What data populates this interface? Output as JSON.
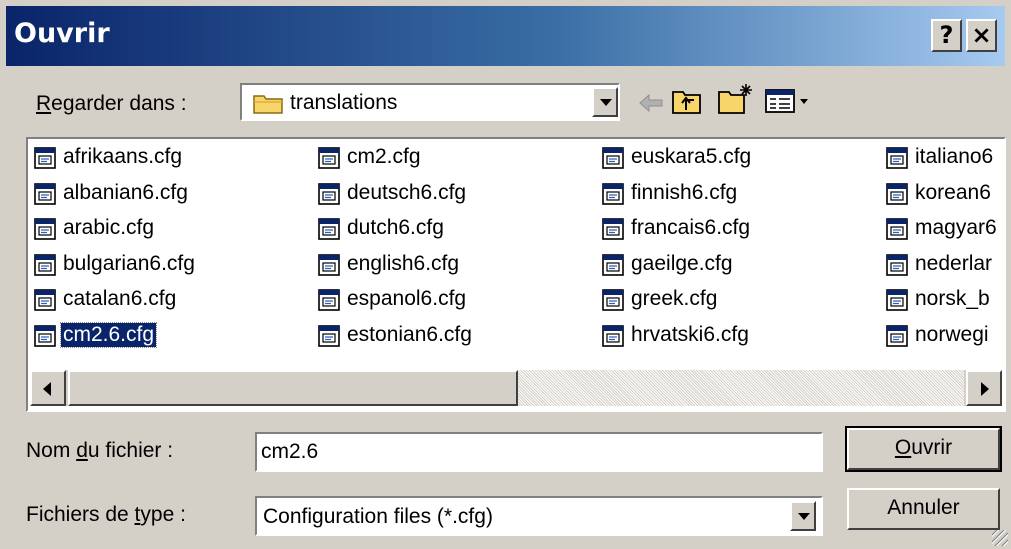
{
  "window": {
    "title": "Ouvrir",
    "help_label": "?",
    "close_label": "×"
  },
  "look_in": {
    "label_prefix": "",
    "label_access": "R",
    "label_rest": "egarder dans :",
    "value": "translations"
  },
  "files": [
    {
      "name": "afrikaans.cfg",
      "col": 0,
      "row": 0
    },
    {
      "name": "albanian6.cfg",
      "col": 0,
      "row": 1
    },
    {
      "name": "arabic.cfg",
      "col": 0,
      "row": 2
    },
    {
      "name": "bulgarian6.cfg",
      "col": 0,
      "row": 3
    },
    {
      "name": "catalan6.cfg",
      "col": 0,
      "row": 4
    },
    {
      "name": "cm2.6.cfg",
      "col": 0,
      "row": 5,
      "selected": true
    },
    {
      "name": "cm2.cfg",
      "col": 1,
      "row": 0
    },
    {
      "name": "deutsch6.cfg",
      "col": 1,
      "row": 1
    },
    {
      "name": "dutch6.cfg",
      "col": 1,
      "row": 2
    },
    {
      "name": "english6.cfg",
      "col": 1,
      "row": 3
    },
    {
      "name": "espanol6.cfg",
      "col": 1,
      "row": 4
    },
    {
      "name": "estonian6.cfg",
      "col": 1,
      "row": 5
    },
    {
      "name": "euskara5.cfg",
      "col": 2,
      "row": 0
    },
    {
      "name": "finnish6.cfg",
      "col": 2,
      "row": 1
    },
    {
      "name": "francais6.cfg",
      "col": 2,
      "row": 2
    },
    {
      "name": "gaeilge.cfg",
      "col": 2,
      "row": 3
    },
    {
      "name": "greek.cfg",
      "col": 2,
      "row": 4
    },
    {
      "name": "hrvatski6.cfg",
      "col": 2,
      "row": 5
    },
    {
      "name": "italiano6",
      "col": 3,
      "row": 0
    },
    {
      "name": "korean6",
      "col": 3,
      "row": 1
    },
    {
      "name": "magyar6",
      "col": 3,
      "row": 2
    },
    {
      "name": "nederlar",
      "col": 3,
      "row": 3
    },
    {
      "name": "norsk_b",
      "col": 3,
      "row": 4
    },
    {
      "name": "norwegi",
      "col": 3,
      "row": 5
    }
  ],
  "filename": {
    "label_pre": "Nom ",
    "label_access": "d",
    "label_post": "u fichier :",
    "value": "cm2.6"
  },
  "filetype": {
    "label_pre": "Fichiers de ",
    "label_access": "t",
    "label_post": "ype :",
    "value": "Configuration files (*.cfg)"
  },
  "buttons": {
    "open_access": "O",
    "open_rest": "uvrir",
    "cancel": "Annuler"
  },
  "colors": {
    "title_start": "#0a246a",
    "title_end": "#a6caf0",
    "selection": "#0a246a",
    "face": "#d4d0c8"
  }
}
